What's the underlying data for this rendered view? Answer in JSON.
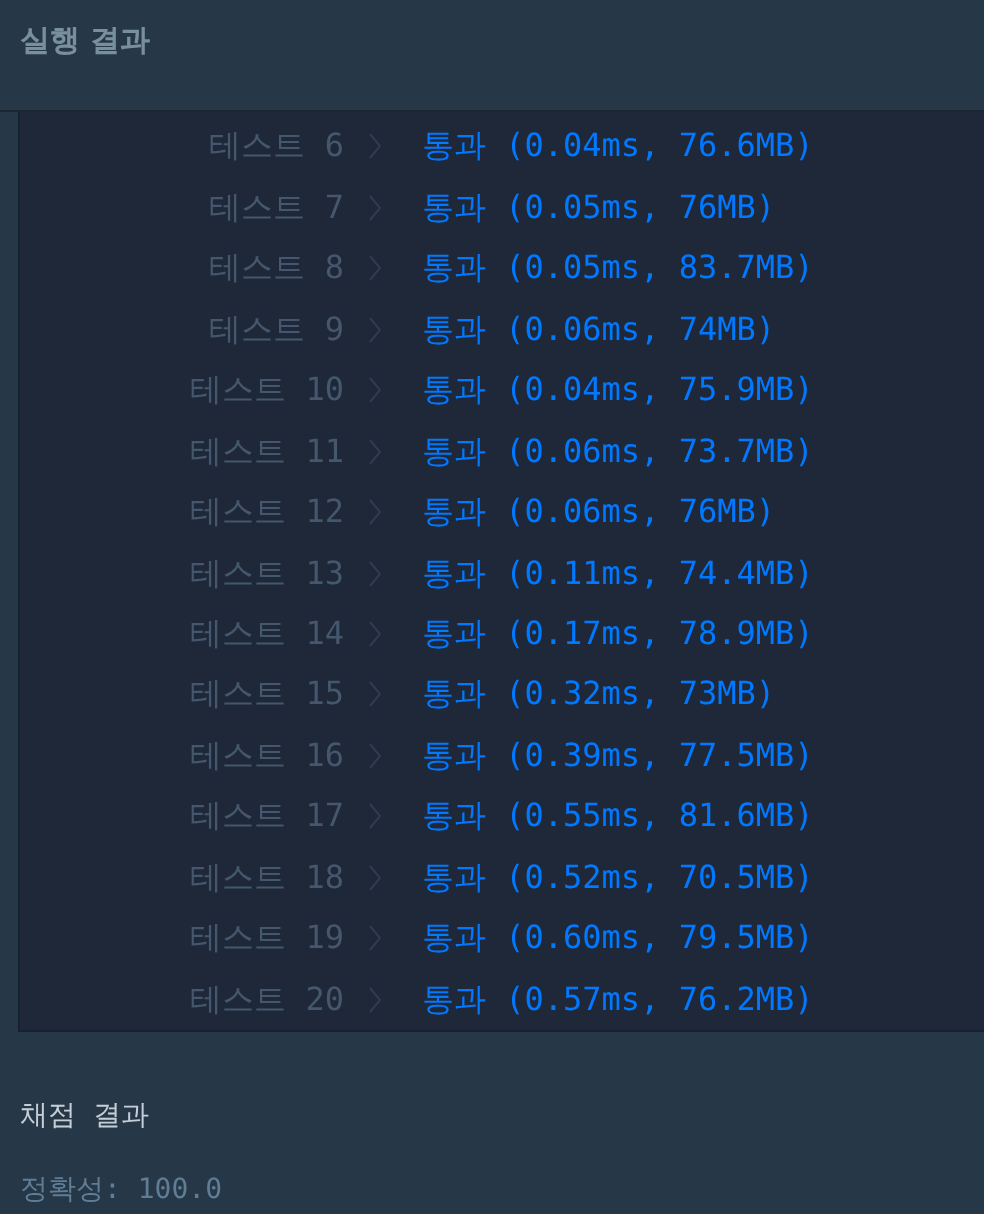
{
  "header": {
    "title": "실행 결과"
  },
  "tests": [
    {
      "label": "테스트 6",
      "result": "통과 (0.04ms, 76.6MB)"
    },
    {
      "label": "테스트 7",
      "result": "통과 (0.05ms, 76MB)"
    },
    {
      "label": "테스트 8",
      "result": "통과 (0.05ms, 83.7MB)"
    },
    {
      "label": "테스트 9",
      "result": "통과 (0.06ms, 74MB)"
    },
    {
      "label": "테스트 10",
      "result": "통과 (0.04ms, 75.9MB)"
    },
    {
      "label": "테스트 11",
      "result": "통과 (0.06ms, 73.7MB)"
    },
    {
      "label": "테스트 12",
      "result": "통과 (0.06ms, 76MB)"
    },
    {
      "label": "테스트 13",
      "result": "통과 (0.11ms, 74.4MB)"
    },
    {
      "label": "테스트 14",
      "result": "통과 (0.17ms, 78.9MB)"
    },
    {
      "label": "테스트 15",
      "result": "통과 (0.32ms, 73MB)"
    },
    {
      "label": "테스트 16",
      "result": "통과 (0.39ms, 77.5MB)"
    },
    {
      "label": "테스트 17",
      "result": "통과 (0.55ms, 81.6MB)"
    },
    {
      "label": "테스트 18",
      "result": "통과 (0.52ms, 70.5MB)"
    },
    {
      "label": "테스트 19",
      "result": "통과 (0.60ms, 79.5MB)"
    },
    {
      "label": "테스트 20",
      "result": "통과 (0.57ms, 76.2MB)"
    }
  ],
  "grading": {
    "title": "채점 결과",
    "accuracy": "정확성: 100.0"
  }
}
